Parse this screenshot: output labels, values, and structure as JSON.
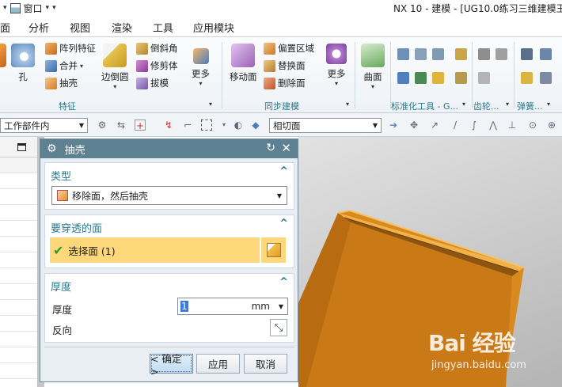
{
  "titlebar": {
    "window_menu": "窗口",
    "app_title": "NX 10 - 建模 - [UG10.0练习三维建模王"
  },
  "menu": {
    "tabs": [
      "面",
      "分析",
      "视图",
      "渲染",
      "工具",
      "应用模块"
    ]
  },
  "ribbon": {
    "feature_group": {
      "label": "特征",
      "hole": "孔",
      "pattern": "阵列特征",
      "unite": "合并",
      "shell": "抽壳",
      "edge_blend": "边倒圆",
      "chamfer": "倒斜角",
      "trim_body": "修剪体",
      "draft": "拔模",
      "more": "更多"
    },
    "sync_group": {
      "label": "同步建模",
      "move_face": "移动面",
      "offset_region": "偏置区域",
      "replace_face": "替换面",
      "delete_face": "删除面",
      "more": "更多"
    },
    "surface": {
      "label": "曲面"
    },
    "std_tools": {
      "label": "标准化工具 - G..."
    },
    "gear": {
      "label": "齿轮..."
    },
    "spring": {
      "label": "弹簧..."
    }
  },
  "selection_bar": {
    "filter_value": "工作部件内",
    "face_rule_value": "相切面"
  },
  "dialog": {
    "title": "抽壳",
    "type_section": {
      "label": "类型",
      "value": "移除面，然后抽壳"
    },
    "pierce_section": {
      "label": "要穿透的面",
      "select_label": "选择面 (1)"
    },
    "thickness_section": {
      "label": "厚度",
      "thickness_label": "厚度",
      "thickness_value": "1",
      "unit": "mm",
      "reverse_label": "反向"
    },
    "buttons": {
      "ok": "< 确定 >",
      "apply": "应用",
      "cancel": "取消"
    }
  },
  "watermark": {
    "logo": "Bai 经验",
    "url": "jingyan.baidu.com"
  },
  "colors": {
    "dialog_header": "#5d8190",
    "section_label": "#2a7a8c",
    "selection_highlight": "#fcd87b",
    "model_orange": "#d98a1e"
  }
}
